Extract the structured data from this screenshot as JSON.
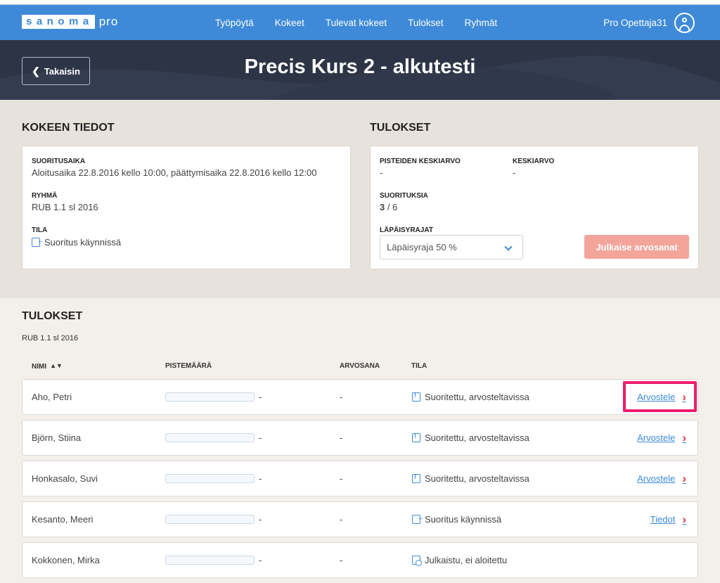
{
  "nav": {
    "logo_word": "sanoma",
    "logo_suffix": "pro",
    "links": [
      "Työpöytä",
      "Kokeet",
      "Tulevat kokeet",
      "Tulokset",
      "Ryhmät"
    ],
    "user": "Pro Opettaja31"
  },
  "banner": {
    "back_label": "Takaisin",
    "title": "Precis Kurs 2 - alkutesti"
  },
  "exam_info": {
    "heading": "KOKEEN TIEDOT",
    "time_label": "SUORITUSAIKA",
    "time_value": "Aloitusaika 22.8.2016 kello 10:00, päättymisaika 22.8.2016 kello 12:00",
    "group_label": "RYHMÄ",
    "group_value": "RUB 1.1 sl 2016",
    "state_label": "TILA",
    "state_value": "Suoritus käynnissä"
  },
  "results_summary": {
    "heading": "TULOKSET",
    "points_avg_label": "PISTEIDEN KESKIARVO",
    "points_avg_value": "-",
    "avg_label": "KESKIARVO",
    "avg_value": "-",
    "attempts_label": "SUORITUKSIA",
    "attempts_done": "3",
    "attempts_total": "/ 6",
    "pass_label": "LÄPÄISYRAJAT",
    "pass_selected": "Läpäisyraja 50 %",
    "publish_button": "Julkaise arvosanat",
    "publish_color": "#f3a59a"
  },
  "results": {
    "heading": "TULOKSET",
    "group": "RUB 1.1 sl 2016",
    "columns": [
      "NIMI",
      "PISTEMÄÄRÄ",
      "ARVOSANA",
      "TILA"
    ],
    "rows": [
      {
        "name": "Aho, Petri",
        "score_text": "-",
        "score_fraction": 0,
        "grade": "-",
        "status": "Suoritettu, arvosteltavissa",
        "status_icon": "alert-doc-icon",
        "action": "Arvostele"
      },
      {
        "name": "Björn, Stiina",
        "score_text": "-",
        "score_fraction": 0,
        "grade": "-",
        "status": "Suoritettu, arvosteltavissa",
        "status_icon": "alert-doc-icon",
        "action": "Arvostele"
      },
      {
        "name": "Honkasalo, Suvi",
        "score_text": "-",
        "score_fraction": 0,
        "grade": "-",
        "status": "Suoritettu, arvosteltavissa",
        "status_icon": "alert-doc-icon",
        "action": "Arvostele"
      },
      {
        "name": "Kesanto, Meeri",
        "score_text": "-",
        "score_fraction": 0,
        "grade": "-",
        "status": "Suoritus käynnissä",
        "status_icon": "in-progress-icon",
        "action": "Tiedot"
      },
      {
        "name": "Kokkonen, Mirka",
        "score_text": "-",
        "score_fraction": 0,
        "grade": "-",
        "status": "Julkaistu, ei aloitettu",
        "status_icon": "published-clock-icon",
        "action": ""
      }
    ]
  },
  "colors": {
    "nav_blue": "#3e8ad8",
    "banner_dark": "#2d3446",
    "arrow_red": "#e0303c",
    "highlight_pink": "#ee1d6d"
  }
}
